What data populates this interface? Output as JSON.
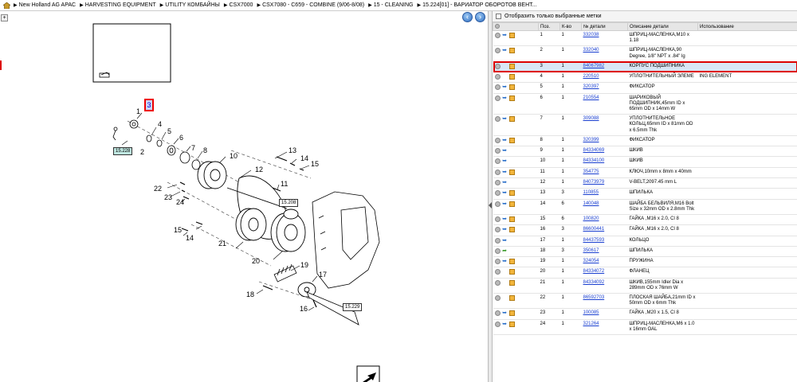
{
  "breadcrumb": [
    "New Holland AG APAC",
    "HARVESTING EQUIPMENT",
    "UTILITY КОМБАЙНЫ",
    "CSX7000",
    "CSX7080 - C659 - COMBINE (9/06-8/08)",
    "15 - CLEANING",
    "15.224[01] - ВАРИАТОР ОБОРОТОВ ВЕНТ..."
  ],
  "filter": {
    "label": "Отобразить только выбранные метки"
  },
  "columns": [
    "Поз.",
    "К-во",
    "№ детали",
    "Описание детали",
    "Использование"
  ],
  "diagram": {
    "numbers": [
      "1",
      "2",
      "3",
      "4",
      "5",
      "6",
      "7",
      "8",
      "10",
      "11",
      "12",
      "13",
      "14",
      "15",
      "16",
      "17",
      "18",
      "19",
      "20",
      "21",
      "22",
      "23",
      "24",
      "9",
      "15",
      "14"
    ],
    "refs": [
      "15.228",
      "15.208",
      "15.229"
    ],
    "callout": "3"
  },
  "rows": [
    {
      "pos": "1",
      "qty": "1",
      "part": "332038",
      "desc": "ШПРИЦ-МАСЛЕНКА,M10 x 1.18",
      "use": "",
      "icon": "arrow",
      "box": true
    },
    {
      "pos": "2",
      "qty": "1",
      "part": "332040",
      "desc": "ШПРИЦ-МАСЛЕНКА,90 Degree, 1/8\" NPT x .84\" lg",
      "use": "",
      "icon": "arrow",
      "box": true
    },
    {
      "pos": "3",
      "qty": "1",
      "part": "84067982",
      "desc": "КОРПУС ПОДШИПНИКА",
      "use": "",
      "icon": "none",
      "box": true,
      "selected": true
    },
    {
      "pos": "4",
      "qty": "1",
      "part": "220510",
      "desc": "УПЛОТНИТЕЛЬНЫЙ ЭЛЕМЕ",
      "use": "ING ELEMENT",
      "icon": "none",
      "box": true
    },
    {
      "pos": "5",
      "qty": "1",
      "part": "320397",
      "desc": "ФИКСАТОР",
      "use": "",
      "icon": "arrow",
      "box": true
    },
    {
      "pos": "6",
      "qty": "1",
      "part": "210554",
      "desc": "ШАРИКОВЫЙ ПОДШИПНИК,45mm ID x 65mm OD x 14mm W",
      "use": "",
      "icon": "arrow",
      "box": true
    },
    {
      "pos": "7",
      "qty": "1",
      "part": "309088",
      "desc": "УПЛОТНИТЕЛЬНОЕ КОЛЬЦ,65mm ID x 81mm OD x 6.5mm Thk",
      "use": "",
      "icon": "arrow",
      "box": true
    },
    {
      "pos": "8",
      "qty": "1",
      "part": "320399",
      "desc": "ФИКСАТОР",
      "use": "",
      "icon": "arrow",
      "box": true
    },
    {
      "pos": "9",
      "qty": "1",
      "part": "84334069",
      "desc": "ШКИВ",
      "use": "",
      "icon": "arrow",
      "box": false
    },
    {
      "pos": "10",
      "qty": "1",
      "part": "84334100",
      "desc": "ШКИВ",
      "use": "",
      "icon": "arrow",
      "box": false
    },
    {
      "pos": "11",
      "qty": "1",
      "part": "354775",
      "desc": "КЛЮЧ,10mm x 8mm x 40mm",
      "use": "",
      "icon": "arrow",
      "box": true
    },
    {
      "pos": "12",
      "qty": "1",
      "part": "84073979",
      "desc": "V-BELT,2097.45 mm L",
      "use": "",
      "icon": "arrow",
      "box": false
    },
    {
      "pos": "13",
      "qty": "3",
      "part": "110855",
      "desc": "ШПИЛЬКА",
      "use": "",
      "icon": "arrow",
      "box": true
    },
    {
      "pos": "14",
      "qty": "6",
      "part": "140048",
      "desc": "ШАЙБА БЕЛЬВИЛЯ,M16 Bolt Size x 32mm OD x 2.8mm Thk",
      "use": "",
      "icon": "arrow",
      "box": true
    },
    {
      "pos": "15",
      "qty": "6",
      "part": "100820",
      "desc": "ГАЙКА ,M16 x 2.0, Cl 8",
      "use": "",
      "icon": "arrow",
      "box": true
    },
    {
      "pos": "16",
      "qty": "3",
      "part": "86600441",
      "desc": "ГАЙКА ,M16 x 2.0, Cl 8",
      "use": "",
      "icon": "arrow",
      "box": true
    },
    {
      "pos": "17",
      "qty": "1",
      "part": "84437593",
      "desc": "КОЛЬЦО",
      "use": "",
      "icon": "arrow",
      "box": false
    },
    {
      "pos": "18",
      "qty": "3",
      "part": "350617",
      "desc": "ШПИЛЬКА",
      "use": "",
      "icon": "green",
      "box": false
    },
    {
      "pos": "19",
      "qty": "1",
      "part": "324054",
      "desc": "ПРУЖИНА",
      "use": "",
      "icon": "arrow",
      "box": true
    },
    {
      "pos": "20",
      "qty": "1",
      "part": "84334072",
      "desc": "ФЛАНЕЦ",
      "use": "",
      "icon": "none",
      "box": true
    },
    {
      "pos": "21",
      "qty": "1",
      "part": "84334092",
      "desc": "ШКИВ,155mm Idler Dia x 289mm OD x 76mm W",
      "use": "",
      "icon": "none",
      "box": true
    },
    {
      "pos": "22",
      "qty": "1",
      "part": "86592703",
      "desc": "ПЛОСКАЯ ШАЙБА,21mm ID x 50mm OD x 6mm Thk",
      "use": "",
      "icon": "none",
      "box": true
    },
    {
      "pos": "23",
      "qty": "1",
      "part": "100085",
      "desc": "ГАЙКА ,M20 x 1.5, Cl 8",
      "use": "",
      "icon": "arrow",
      "box": true
    },
    {
      "pos": "24",
      "qty": "1",
      "part": "321264",
      "desc": "ШПРИЦ-МАСЛЕНКА,M6 x 1.0 x 16mm OAL",
      "use": "",
      "icon": "arrow",
      "box": true
    }
  ]
}
